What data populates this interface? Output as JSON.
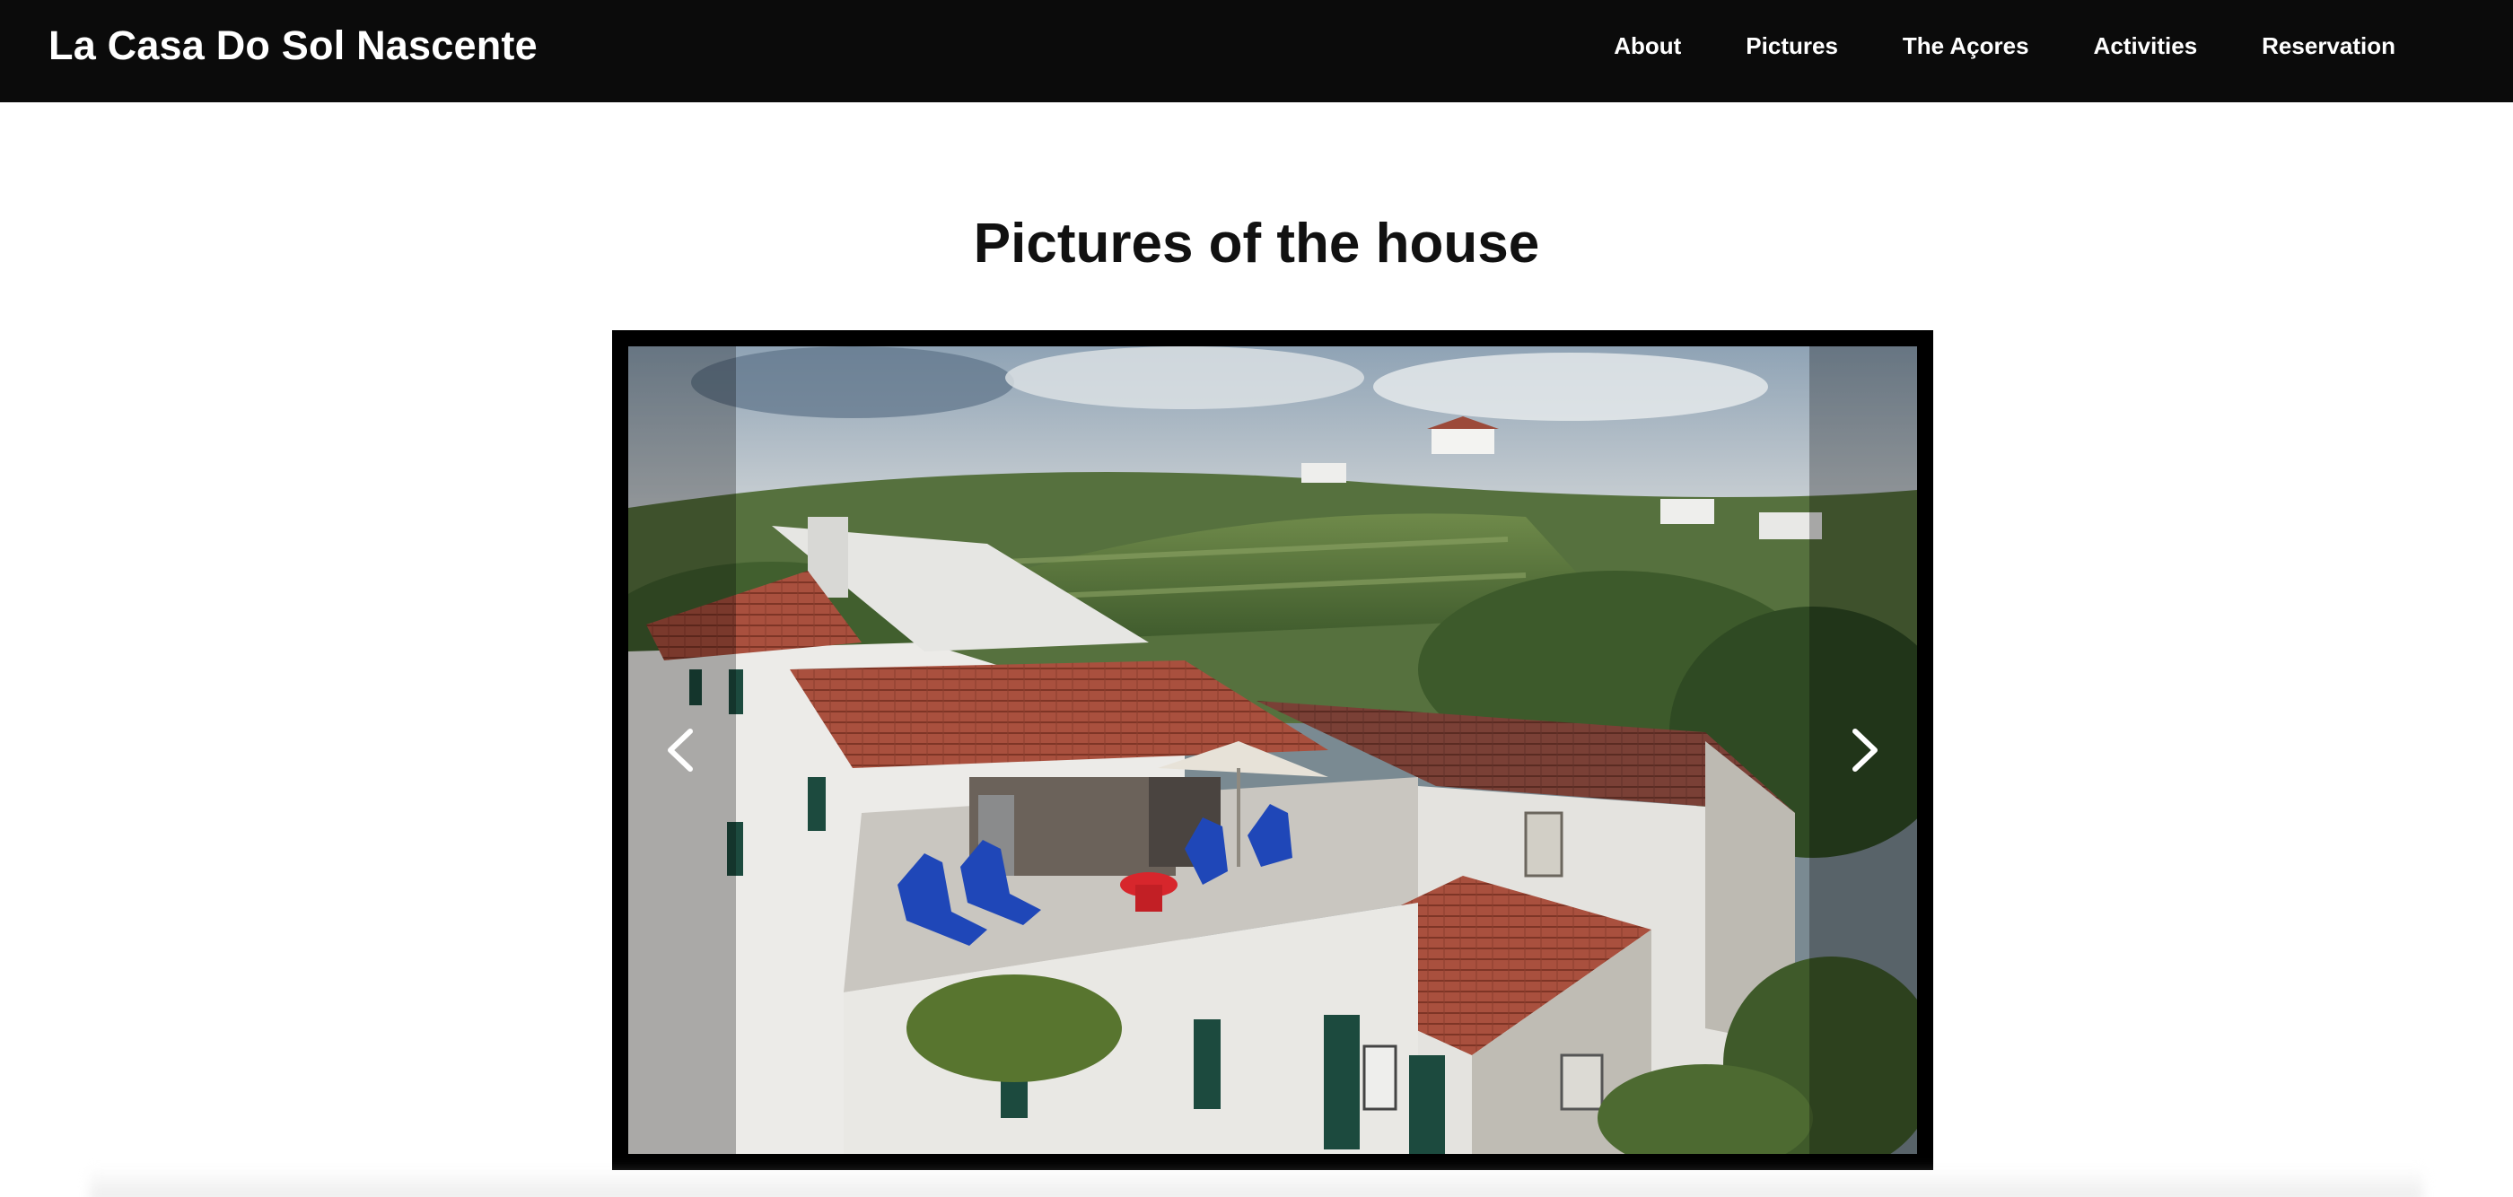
{
  "header": {
    "brand": "La Casa Do Sol Nascente",
    "nav": [
      {
        "label": "About"
      },
      {
        "label": "Pictures"
      },
      {
        "label": "The Açores"
      },
      {
        "label": "Activities"
      },
      {
        "label": "Reservation"
      }
    ]
  },
  "main": {
    "title": "Pictures of the house",
    "carousel": {
      "prev_icon": "chevron-left-icon",
      "next_icon": "chevron-right-icon",
      "photo_alt": "Aerial view of the white house with terracotta roofs and terrace"
    }
  },
  "colors": {
    "nav_bg": "#0b0b0b",
    "nav_text": "#ffffff",
    "page_bg": "#ffffff",
    "carousel_frame": "#000000",
    "roof": "#a9503e",
    "wall": "#f2f2f0",
    "chairs": "#1f47b8"
  }
}
